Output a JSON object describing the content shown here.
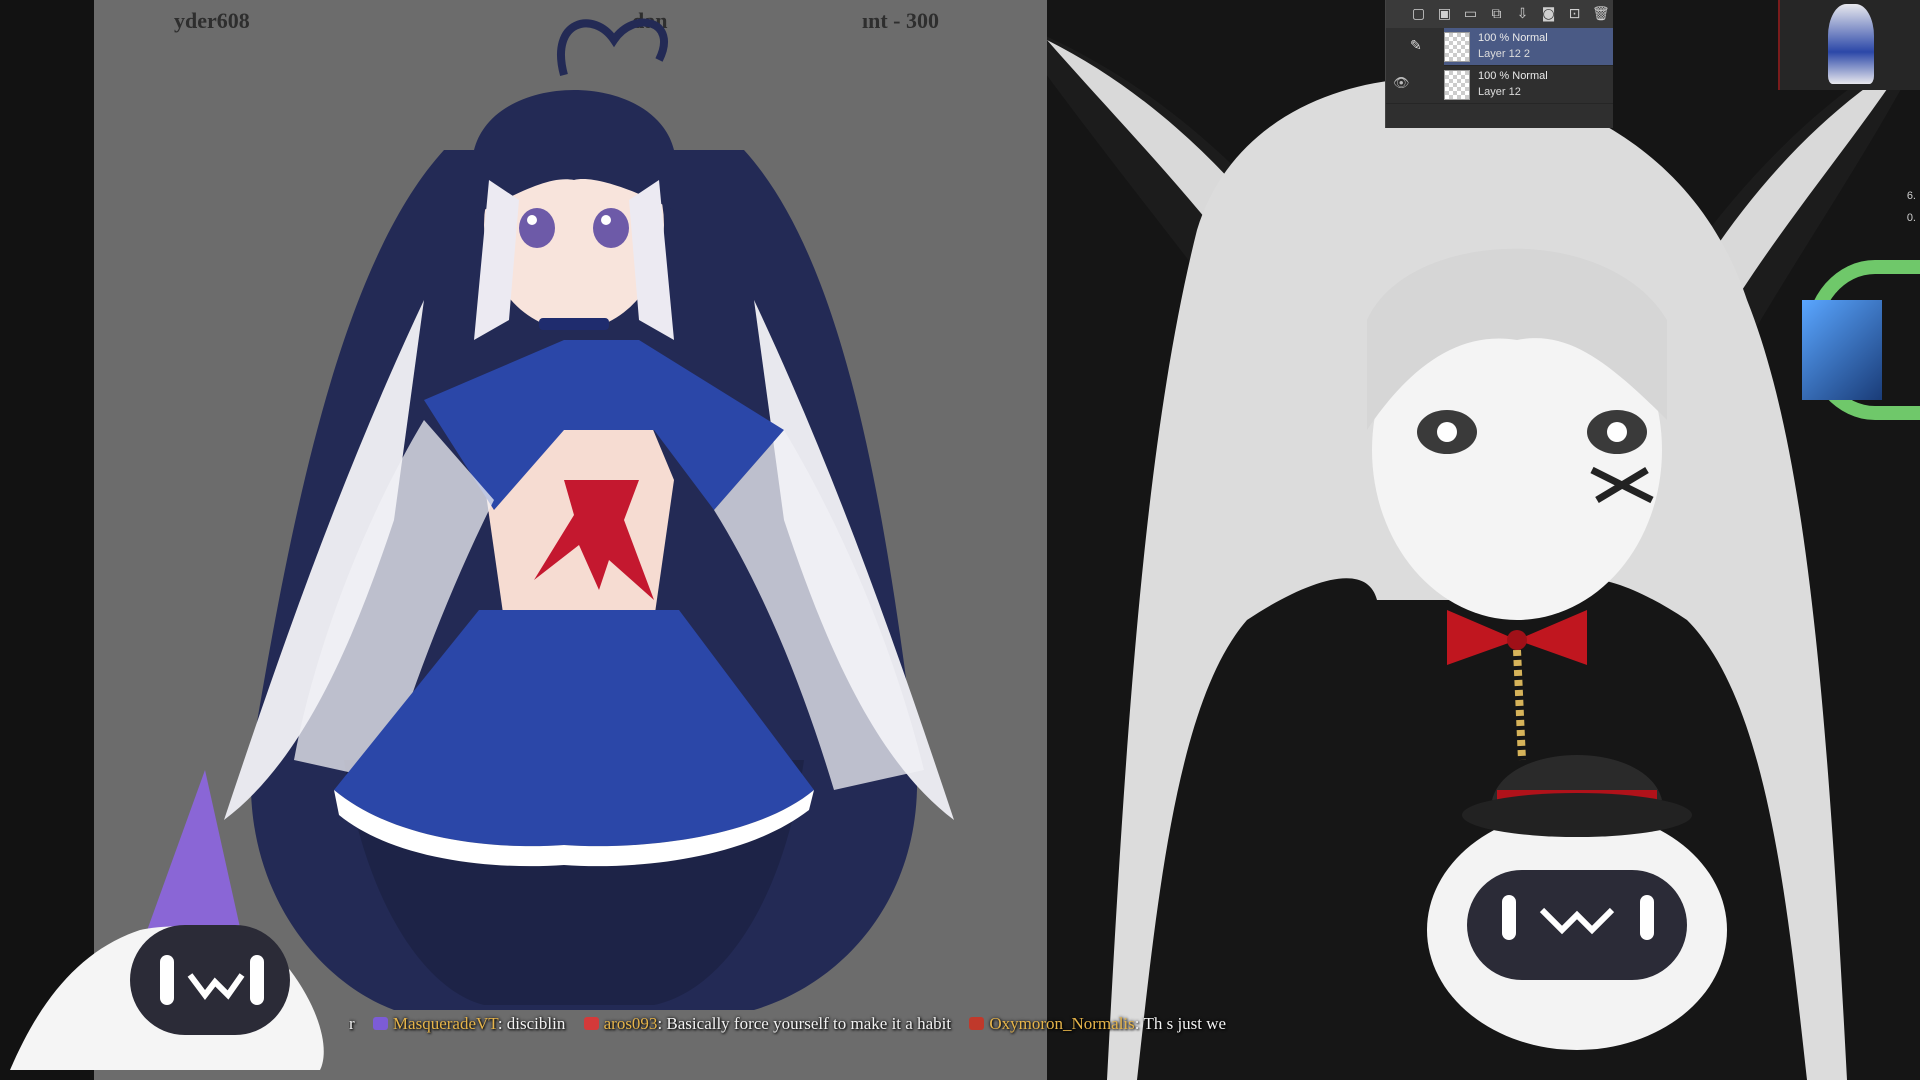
{
  "canvas": {
    "header_left": "yder608",
    "header_center": "dan",
    "header_right": "ınt - 300"
  },
  "layer_panel": {
    "toolbar_icons": [
      "new-raster-layer-icon",
      "new-vector-layer-icon",
      "new-folder-icon",
      "copy-layer-icon",
      "merge-layer-icon",
      "mask-icon",
      "reference-icon",
      "delete-layer-icon"
    ],
    "layers": [
      {
        "mode": "100 % Normal",
        "name": "Layer 12 2",
        "selected": true
      },
      {
        "mode": "100 % Normal",
        "name": "Layer 12",
        "selected": false
      }
    ]
  },
  "side_numbers": [
    "6.",
    "0."
  ],
  "chat": [
    {
      "user": "",
      "message": "r",
      "badge_color": "#e8e8e8"
    },
    {
      "user": "MasqueradeVT",
      "message": "disciblin",
      "badge_color": "#7c5cd6"
    },
    {
      "user": "aros093",
      "message": "Basically force yourself to make it a habit",
      "badge_color": "#d43a3a"
    },
    {
      "user": "Oxymoron_Normalis",
      "message": "Th  s just we",
      "badge_color": "#c0392b"
    }
  ],
  "colors": {
    "canvas_bg": "#6c6c6c",
    "workspace_bg": "#151515",
    "layer_selected": "#4a5a85",
    "chat_username": "#e6b44a",
    "ribbon_red": "#c4182f",
    "skirt_blue": "#2b47a8"
  }
}
